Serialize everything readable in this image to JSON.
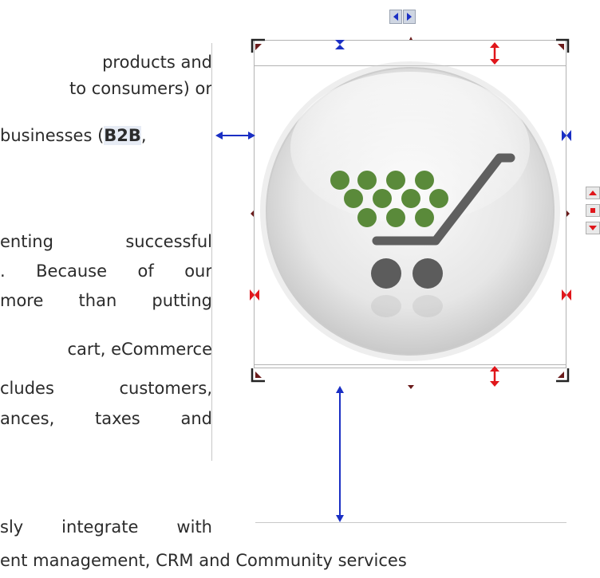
{
  "article": {
    "lines": [
      {
        "text": "products  and",
        "align": "right"
      },
      {
        "text": "to consumers) or",
        "align": "right"
      },
      {
        "pre": "businesses (",
        "bold": "B2B",
        "post": ","
      },
      {
        "text": "enting successful",
        "align": "justify"
      },
      {
        "text": ". Because of our",
        "align": "justify"
      },
      {
        "text": "more than putting",
        "align": "justify"
      },
      {
        "text": "cart, eCommerce",
        "align": "right"
      },
      {
        "text": "cludes customers,",
        "align": "justify"
      },
      {
        "text": "ances, taxes and",
        "align": "justify"
      },
      {
        "text": "sly integrate with",
        "align": "justify"
      },
      {
        "text": "ent management, CRM and Community services"
      }
    ]
  },
  "image": {
    "icon": "shopping-cart-glossy-button",
    "colors": {
      "dots": "#5a8a3a",
      "cart": "#5f5f5f",
      "button": "#e9e9e9"
    }
  },
  "handles": {
    "margin_color": "#1a2fc4",
    "padding_color": "#e0161b",
    "corner_color": "#222222"
  }
}
